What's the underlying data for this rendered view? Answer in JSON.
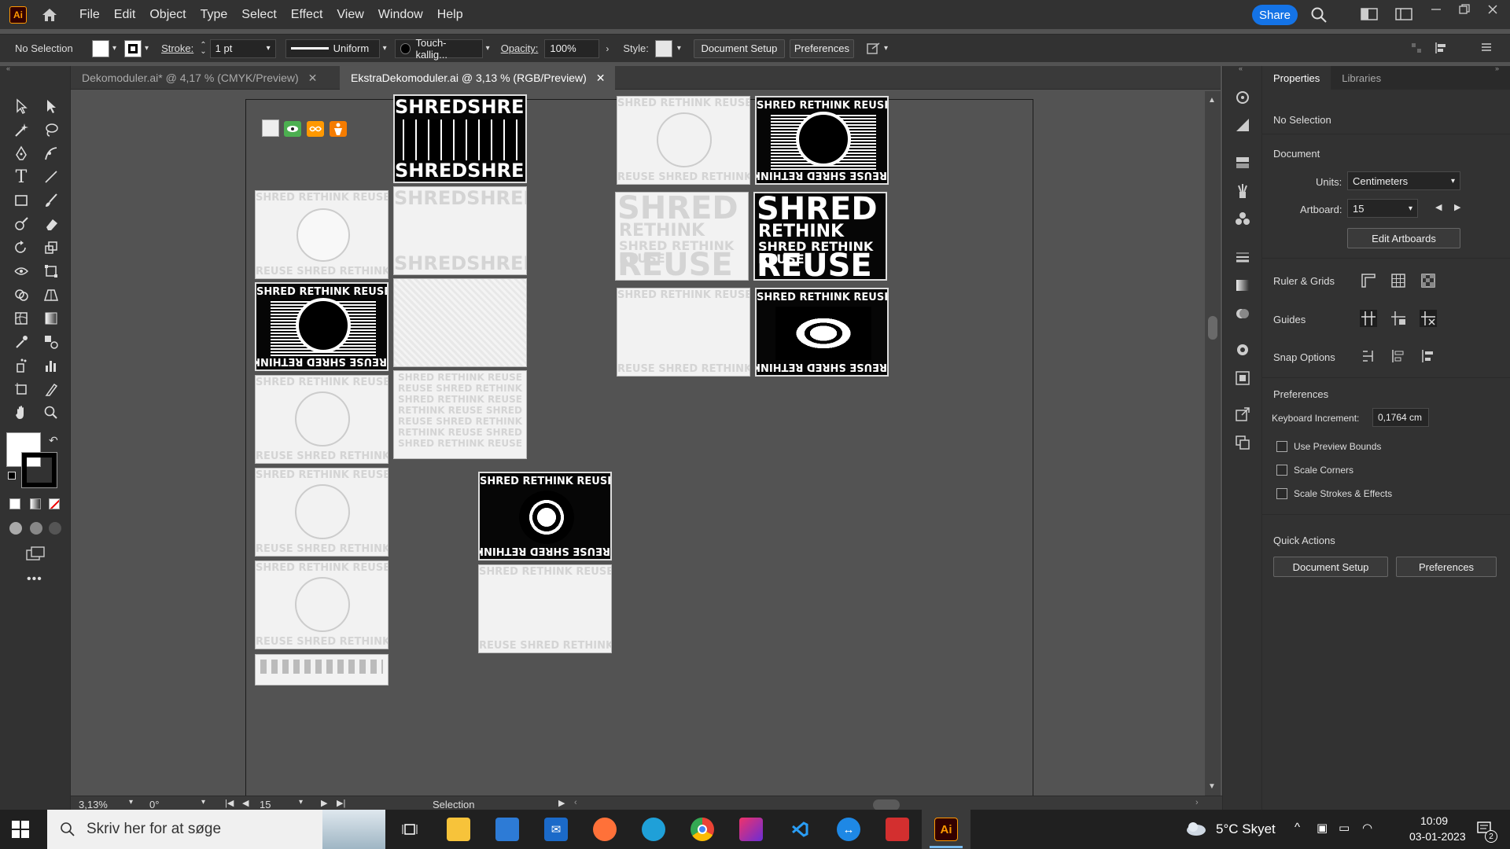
{
  "app": {
    "logo": "Ai",
    "accent": "#ff9a00"
  },
  "menu": [
    "File",
    "Edit",
    "Object",
    "Type",
    "Select",
    "Effect",
    "View",
    "Window",
    "Help"
  ],
  "share_label": "Share",
  "control": {
    "selection": "No Selection",
    "stroke_label": "Stroke:",
    "stroke_value": "1 pt",
    "profile": "Uniform",
    "brush": "Touch-kallig...",
    "opacity_label": "Opacity:",
    "opacity_value": "100%",
    "style_label": "Style:",
    "doc_setup": "Document Setup",
    "preferences": "Preferences"
  },
  "tabs": [
    {
      "label": "Dekomoduler.ai* @ 4,17 % (CMYK/Preview)",
      "active": false
    },
    {
      "label": "EkstraDekomoduler.ai @ 3,13 % (RGB/Preview)",
      "active": true
    }
  ],
  "artwork": {
    "shred": "SHRED",
    "rethink": "RETHINK",
    "reuse": "REUSE",
    "shredshred": "SHREDSHRED",
    "row1": "SHRED RETHINK REUSE",
    "row2": "REUSE SHRED RETHINK",
    "row3": "RETHINK REUSE SHRED",
    "row_b": "REUSE SHRED RETHINK",
    "side": "SHRED",
    "side2": "RETHINK",
    "side3": "REUSE"
  },
  "panel": {
    "tab_properties": "Properties",
    "tab_libraries": "Libraries",
    "no_selection": "No Selection",
    "document": "Document",
    "units_label": "Units:",
    "units_value": "Centimeters",
    "artboard_label": "Artboard:",
    "artboard_value": "15",
    "edit_artboards": "Edit Artboards",
    "ruler_grids": "Ruler & Grids",
    "guides": "Guides",
    "snap_options": "Snap Options",
    "preferences": "Preferences",
    "keyboard_label": "Keyboard Increment:",
    "keyboard_value": "0,1764 cm",
    "use_preview_bounds": "Use Preview Bounds",
    "scale_corners": "Scale Corners",
    "scale_strokes": "Scale Strokes & Effects",
    "quick_actions": "Quick Actions",
    "qa_doc_setup": "Document Setup",
    "qa_preferences": "Preferences"
  },
  "status": {
    "zoom": "3,13%",
    "rotation": "0°",
    "artboard": "15",
    "tool": "Selection"
  },
  "taskbar": {
    "search_placeholder": "Skriv her for at søge",
    "weather": "5°C  Skyet",
    "time": "10:09",
    "date": "03-01-2023",
    "notifications": "2"
  }
}
